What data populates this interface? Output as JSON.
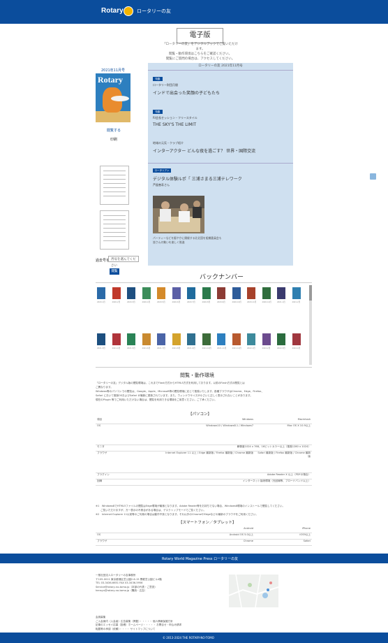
{
  "header": {
    "brand": "Rotary",
    "subtitle": "ロータリーの友"
  },
  "edition": {
    "title": "電子版",
    "intro": [
      "「ロータリーの友」をデジタルブックでご覧いただけます。",
      "閲覧・動作環境はこちらをご確認ください。",
      "閲覧にご質問の場合は、アクセスしてください。"
    ]
  },
  "cover": {
    "date": "2021年11月号",
    "logo": "Rotary",
    "read_link": "閲覧する",
    "print_link": "印刷"
  },
  "back_select": {
    "label": "過去号を",
    "value": "月号を選んでください"
  },
  "go_button": "閲覧",
  "toc": {
    "heading": "ロータリーの友 2021年11月号",
    "items": [
      {
        "badge": "特集",
        "category": "ロータリー財団月間",
        "title": "インドで出会った笑顔の子どもたち"
      },
      {
        "badge": "特集",
        "category": "RI会長セッション・フリースタイル",
        "title": "THE SKY'S THE LIMIT"
      },
      {
        "badge": "",
        "category": "地域の元気・クラブ紹介",
        "title": "インターアクター どんな夜を過ごす？ 世界・国際交流"
      },
      {
        "badge": "ロータリアン",
        "category": "",
        "title": "デジタル体験ルポ「 三浦さまる三浦テレワーク"
      }
    ],
    "author": "芦屋善寿さん",
    "caption": [
      "パーティーなどを賑やかに開催する北北国を組織委員会も",
      "皆さんの集いを楽しく推進"
    ]
  },
  "backnumber": {
    "title": "バックナンバー",
    "row1_labels": [
      "2020.1月",
      "2020.2月",
      "2020.3月",
      "2020.4月",
      "2020.5月",
      "2020.6月",
      "2020.7月",
      "2020.8月",
      "2020.9月",
      "2020.10月",
      "2020.11月",
      "2020.12月",
      "2021.1月",
      "2021.2月"
    ],
    "row2_labels": [
      "2021.3月",
      "2021.4月",
      "2021.5月",
      "2021.6月",
      "2021.7月",
      "2021.8月",
      "2021.9月",
      "2021.10月",
      "2021.11月",
      "2021.12月",
      "2022.1月",
      "2022.2月",
      "2022.3月",
      "2022.4月"
    ],
    "row1_colors": [
      "#2a6aa8",
      "#c0392b",
      "#1e4f80",
      "#3c8d5a",
      "#d48a2a",
      "#5b5fa6",
      "#1f6b9d",
      "#2b7a4b",
      "#8c3b34",
      "#2e5c9a",
      "#a7412a",
      "#306e3d",
      "#3a3a6e",
      "#2f7fb0"
    ],
    "row2_colors": [
      "#1c4f7f",
      "#b0343b",
      "#2a8356",
      "#c98a30",
      "#4a64a7",
      "#d4a32c",
      "#2f7090",
      "#3d6c3a",
      "#2d7fbf",
      "#b85a2f",
      "#3d8a9c",
      "#6c4b8e",
      "#2b6c3e",
      "#a0373f"
    ]
  },
  "environment": {
    "title": "閲覧・動作環境",
    "text": [
      "「ロータリーの友」デジタル版の閲覧環境は、これまでFlash方式からHTML5方式を利用しております。以前のFlash方式の閲覧とは",
      "ご異なります。",
      "Windows等のパソコンでの閲覧は、Google、Apple、Microsoft等の閲覧環境に応じて推奨いたします。各種ブラウザはChrome、Edge、Firefox、",
      "Safari において推奨OSおよびSafari が最新に更新されています。また、ウィンドウサイズが小さいと正しく表示されないことがあります。",
      "現在のPlugin 等でご利用いただけない場合は、閲覧を利用できる環境をご用意ください。ご了承ください。"
    ],
    "pc_heading": "【パソコン】",
    "pc_header": [
      "",
      "Windows",
      "Macintosh"
    ],
    "pc_rows": [
      [
        "項目",
        "Windows",
        "Macintosh"
      ],
      [
        "OS",
        "Windows10 / Windows8.1 / Windows7",
        "Mac OS X 10.9以上"
      ],
      [
        "モニタ",
        "解像度1024 x 768、16ビットカラー以上（推奨1280 x 1024）",
        ""
      ],
      [
        "ブラウザ",
        "Internet Explorer 11 以上 / Edge 最新版 / Firefox 最新版 / Chrome 最新版",
        "Safari 最新版 / Firefox 最新版 / Chrome 最新版"
      ],
      [
        "プラグイン",
        "Adobe Reader X 以上（PDFの場合）",
        ""
      ],
      [
        "回線",
        "インターネット接続環境（光回線等、ブロードバンド以上）",
        ""
      ]
    ],
    "notes": [
      "※1　Windows8でHTML5ファイルの閲覧はEdge環境が最適となります。Adobe Reader等をお持ちでない場合、Windows8環境のインストールで閲覧してください。",
      "　　ご覧いただけますが、万一表示の不具合がある場合は、デスクトップモードでご覧ください。",
      "※2　Internet Explorer 11以前等のご利用の場合は動作不良となります。それ以外のChromeやEdgeなどの最新のブラウザをご利用ください。"
    ],
    "sp_heading": "【スマートフォン／タブレット】",
    "sp_rows": [
      [
        "",
        "Android",
        "iPhone"
      ],
      [
        "OS",
        "Android OS 5.0以上",
        "iOS9以上"
      ],
      [
        "ブラウザ",
        "Chrome",
        "Safari"
      ]
    ]
  },
  "footer": {
    "strip": "Rotary World Magazine Press ロータリーの友",
    "info": [
      "一般社団法人ロータリーの友事務所",
      "〒105-0011 東京都港区芝公園2-6-15 黒龍芝公園ビル4階",
      "TEL 03-3436-6651 FAX 03-3436-5956",
      "Service@rotary-no-tomo.jp（本部の代表・ご意見）",
      "hensyu@rotary-no-tomo.jp（購読・広告）"
    ],
    "links": [
      "会員募集",
      "ご入会案内（入会者）広告募集（掲載）・・・・・ 個人情報保護方針",
      "記事のエッセイ応募（投稿）ホームページ・・・・・ お問合せ・申込み請求",
      "転載等の承認（依頼）・・・・ サイトマップについて"
    ],
    "copyright": "© 2013-2024 THE ROTARY-NO-TOMO"
  },
  "colors": {
    "brand_blue": "#0b4d9c",
    "toc_bg": "#cfe0f0",
    "gold": "#f4b400"
  }
}
